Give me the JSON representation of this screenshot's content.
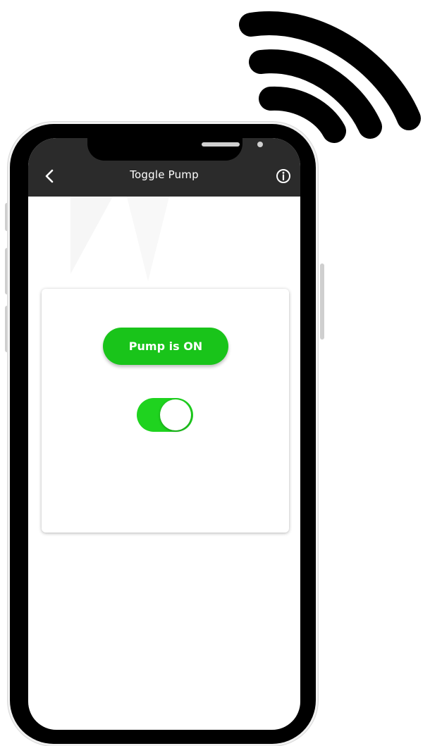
{
  "header": {
    "title": "Toggle Pump",
    "back_icon": "chevron-left-icon",
    "info_icon": "info-circle-icon"
  },
  "pump": {
    "status_label": "Pump is ON",
    "is_on": true
  },
  "colors": {
    "appbar": "#2b2b2b",
    "status_green": "#19c41a",
    "toggle_green": "#1fd31f",
    "frame": "#000000"
  },
  "decor": {
    "signal_icon": "wifi-signal-icon"
  }
}
